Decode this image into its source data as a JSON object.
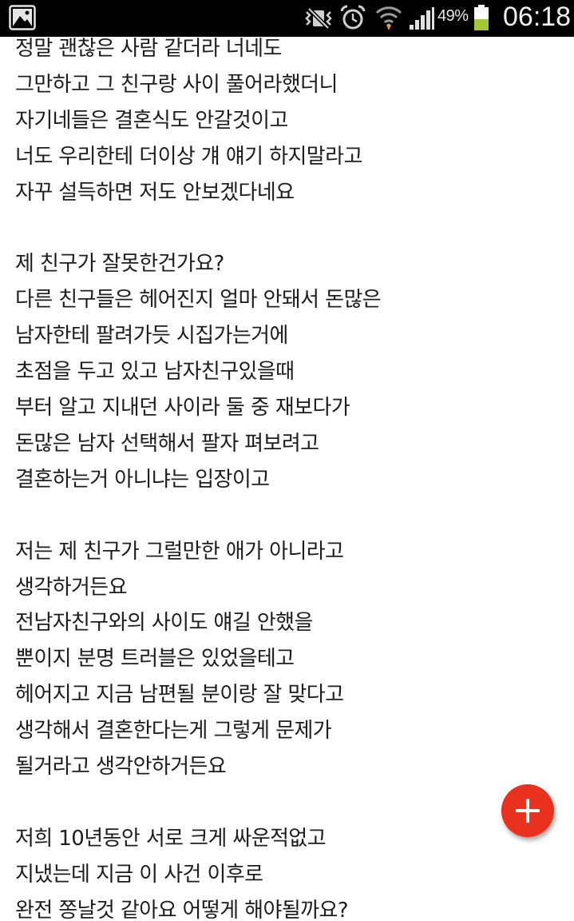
{
  "status_bar": {
    "icons": [
      "gallery-icon",
      "vibrate-mute-icon",
      "alarm-icon",
      "wifi-icon",
      "signal-icon",
      "battery-icon"
    ],
    "battery_percent": "49%",
    "battery_level": 0.49,
    "clock": "06:18"
  },
  "post": {
    "lines": [
      "정말 괜찮은 사람 같더라 너네도",
      "그만하고 그 친구랑 사이 풀어라했더니",
      "자기네들은 결혼식도 안갈것이고",
      "너도 우리한테 더이상 걔 얘기 하지말라고",
      "자꾸 설득하면 저도 안보겠다네요",
      "",
      "제 친구가 잘못한건가요?",
      "다른 친구들은 헤어진지 얼마 안돼서 돈많은",
      "남자한테 팔려가듯 시집가는거에",
      "초점을 두고 있고 남자친구있을때",
      "부터 알고 지내던 사이라 둘 중 재보다가",
      "돈많은 남자 선택해서 팔자 펴보려고",
      "결혼하는거 아니냐는 입장이고",
      "",
      "저는 제 친구가 그럴만한 애가 아니라고",
      "생각하거든요",
      "전남자친구와의 사이도 얘길 안했을",
      "뿐이지 분명 트러블은 있었을테고",
      "헤어지고 지금 남편될 분이랑 잘 맞다고",
      "생각해서 결혼한다는게 그렇게 문제가",
      "될거라고 생각안하거든요",
      "",
      "저희 10년동안 서로 크게 싸운적없고",
      "지냈는데 지금 이 사건 이후로",
      "완전 쫑날것 같아요 어떻게 해야될까요?"
    ]
  },
  "fab": {
    "icon": "plus-icon",
    "color": "#e8321f"
  }
}
